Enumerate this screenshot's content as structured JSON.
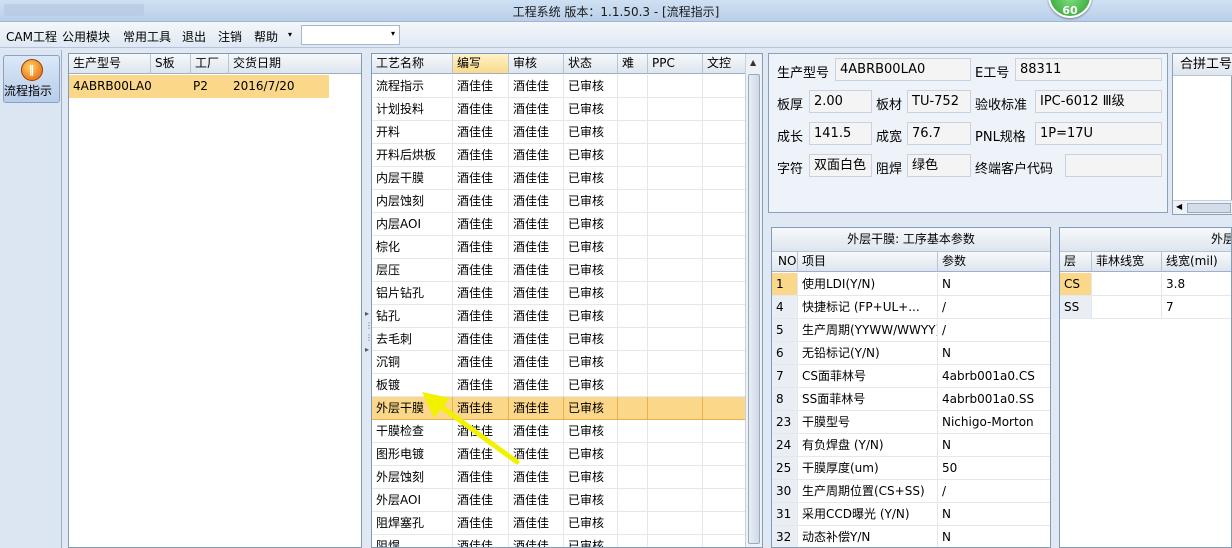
{
  "window": {
    "title": "工程系统   版本：1.1.50.3 - [流程指示]",
    "badge": "60"
  },
  "menu": {
    "items": [
      "CAM工程",
      "公用模块",
      "常用工具",
      "退出",
      "注销",
      "帮助"
    ],
    "dropdown_arrow": "▾",
    "combo_value": ""
  },
  "nav": {
    "button_label": "流程指示",
    "icon": "process-flow-icon"
  },
  "product_grid": {
    "columns": [
      "生产型号",
      "S板",
      "工厂",
      "交货日期"
    ],
    "rows": [
      [
        "4ABRB00LA0",
        "",
        "P2",
        "2016/7/20"
      ]
    ]
  },
  "process_grid": {
    "columns": [
      "工艺名称",
      "编写",
      "审核",
      "状态",
      "难",
      "PPC",
      "文控"
    ],
    "selected_row_index": 15,
    "rows": [
      [
        "流程指示",
        "酒佳佳",
        "酒佳佳",
        "已审核"
      ],
      [
        "计划投料",
        "酒佳佳",
        "酒佳佳",
        "已审核"
      ],
      [
        "开料",
        "酒佳佳",
        "酒佳佳",
        "已审核"
      ],
      [
        "开料后烘板",
        "酒佳佳",
        "酒佳佳",
        "已审核"
      ],
      [
        "内层干膜",
        "酒佳佳",
        "酒佳佳",
        "已审核"
      ],
      [
        "内层蚀刻",
        "酒佳佳",
        "酒佳佳",
        "已审核"
      ],
      [
        "内层AOI",
        "酒佳佳",
        "酒佳佳",
        "已审核"
      ],
      [
        "棕化",
        "酒佳佳",
        "酒佳佳",
        "已审核"
      ],
      [
        "层压",
        "酒佳佳",
        "酒佳佳",
        "已审核"
      ],
      [
        "铝片钻孔",
        "酒佳佳",
        "酒佳佳",
        "已审核"
      ],
      [
        "钻孔",
        "酒佳佳",
        "酒佳佳",
        "已审核"
      ],
      [
        "去毛刺",
        "酒佳佳",
        "酒佳佳",
        "已审核"
      ],
      [
        "沉铜",
        "酒佳佳",
        "酒佳佳",
        "已审核"
      ],
      [
        "板镀",
        "酒佳佳",
        "酒佳佳",
        "已审核"
      ],
      [
        "外层干膜",
        "酒佳佳",
        "酒佳佳",
        "已审核"
      ],
      [
        "干膜检查",
        "酒佳佳",
        "酒佳佳",
        "已审核"
      ],
      [
        "图形电镀",
        "酒佳佳",
        "酒佳佳",
        "已审核"
      ],
      [
        "外层蚀刻",
        "酒佳佳",
        "酒佳佳",
        "已审核"
      ],
      [
        "外层AOI",
        "酒佳佳",
        "酒佳佳",
        "已审核"
      ],
      [
        "阻焊塞孔",
        "酒佳佳",
        "酒佳佳",
        "已审核"
      ],
      [
        "阻焊",
        "酒佳佳",
        "酒佳佳",
        "已审核"
      ]
    ]
  },
  "info": {
    "fields": [
      {
        "label": "生产型号",
        "value": "4ABRB00LA0"
      },
      {
        "label": "E工号",
        "value": "88311"
      },
      {
        "label": "板厚",
        "value": "2.00"
      },
      {
        "label": "板材",
        "value": "TU-752"
      },
      {
        "label": "验收标准",
        "value": "IPC-6012 Ⅲ级"
      },
      {
        "label": "成长",
        "value": "141.5"
      },
      {
        "label": "成宽",
        "value": "76.7"
      },
      {
        "label": "PNL规格",
        "value": "1P=17U"
      },
      {
        "label": "字符",
        "value": "双面白色"
      },
      {
        "label": "阻焊",
        "value": "绿色"
      },
      {
        "label": "终端客户代码",
        "value": ""
      }
    ]
  },
  "right_panel": {
    "header": "合拼工号"
  },
  "params": {
    "title": "外层干膜: 工序基本参数",
    "columns": [
      "NO",
      "项目",
      "参数"
    ],
    "rows": [
      [
        "1",
        "使用LDI(Y/N)",
        "N"
      ],
      [
        "4",
        "快捷标记 (FP+UL+...",
        "/"
      ],
      [
        "5",
        "生产周期(YYWW/WWYY)",
        "/"
      ],
      [
        "6",
        "无铅标记(Y/N)",
        "N"
      ],
      [
        "7",
        "CS面菲林号",
        "4abrb001a0.CS"
      ],
      [
        "8",
        "SS面菲林号",
        "4abrb001a0.SS"
      ],
      [
        "23",
        "干膜型号",
        "Nichigo-Morton"
      ],
      [
        "24",
        "有负焊盘 (Y/N)",
        "N"
      ],
      [
        "25",
        "干膜厚度(um)",
        "50"
      ],
      [
        "30",
        "生产周期位置(CS+SS)",
        "/"
      ],
      [
        "31",
        "采用CCD曝光 (Y/N)",
        "N"
      ],
      [
        "32",
        "动态补偿Y/N",
        "N"
      ]
    ]
  },
  "params2": {
    "title": "外层",
    "columns": [
      "层",
      "菲林线宽",
      "线宽(mil)"
    ],
    "rows": [
      [
        "CS",
        "",
        "3.8"
      ],
      [
        "SS",
        "",
        "7"
      ]
    ]
  },
  "colors": {
    "selected_row": "#fbd78a",
    "annotation_arrow": "#f2f200"
  }
}
